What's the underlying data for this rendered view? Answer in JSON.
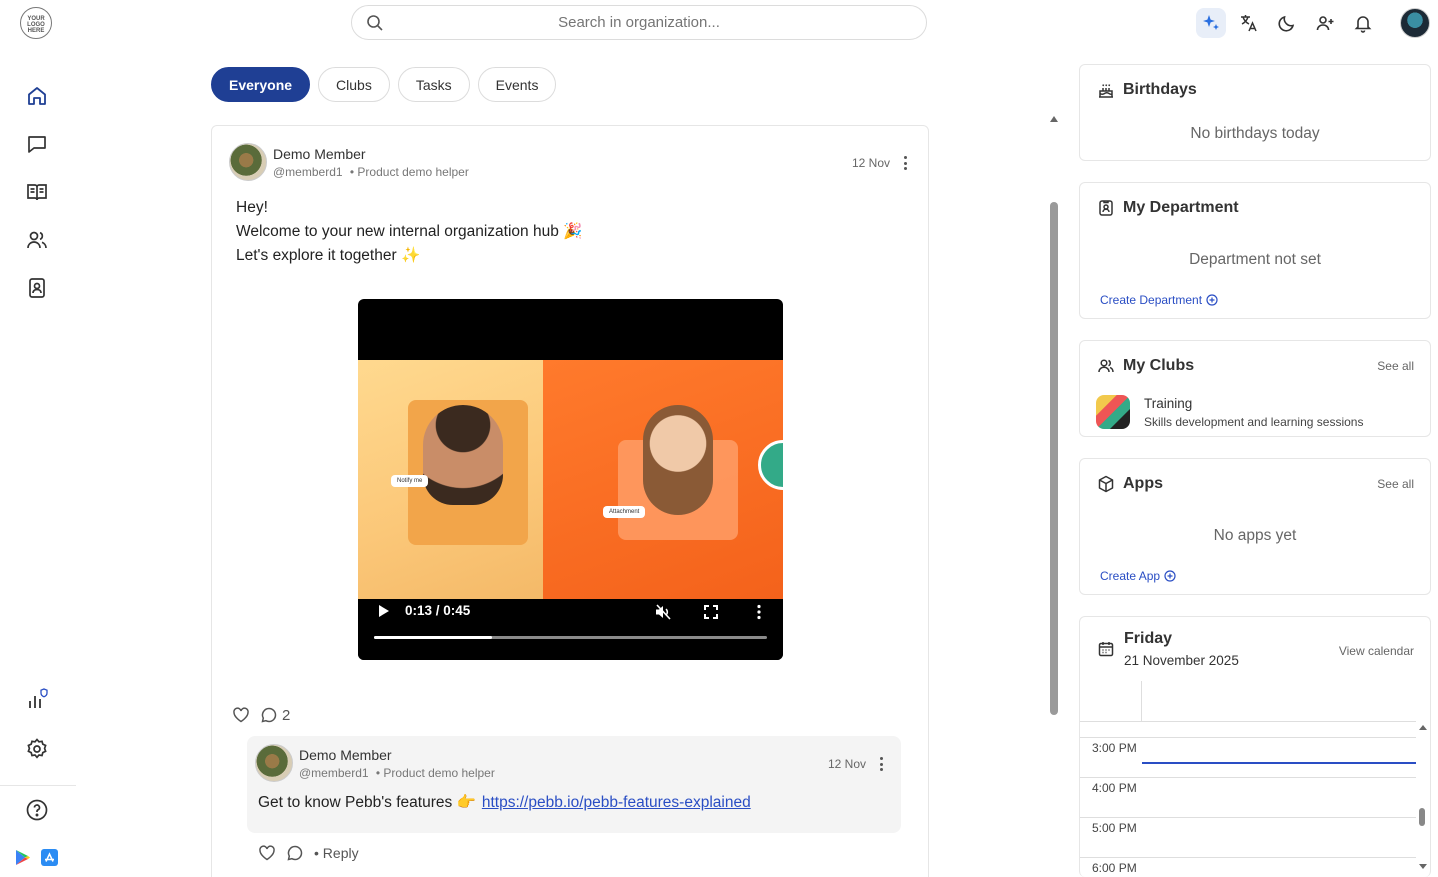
{
  "app": {
    "logo_text": "YOUR LOGO HERE"
  },
  "search": {
    "placeholder": "Search in organization..."
  },
  "tabs": [
    {
      "label": "Everyone",
      "active": true
    },
    {
      "label": "Clubs"
    },
    {
      "label": "Tasks"
    },
    {
      "label": "Events"
    }
  ],
  "post": {
    "author": "Demo Member",
    "handle": "@memberd1",
    "role": "• Product demo helper",
    "date": "12 Nov",
    "lines": [
      "Hey!",
      "Welcome to your new internal organization hub 🎉",
      "Let's explore it together ✨"
    ],
    "video": {
      "time": "0:13 / 0:45",
      "progress": 0.3,
      "chip_notify": "Notify me",
      "chip_attach": "Attachment"
    },
    "comment_count": "2"
  },
  "comment": {
    "author": "Demo Member",
    "handle": "@memberd1",
    "role": "• Product demo helper",
    "date": "12 Nov",
    "text": "Get to know Pebb's features 👉",
    "link": "https://pebb.io/pebb-features-explained",
    "reply_label": "• Reply"
  },
  "widgets": {
    "birthdays": {
      "title": "Birthdays",
      "empty": "No birthdays today"
    },
    "department": {
      "title": "My Department",
      "empty": "Department not set",
      "link": "Create Department"
    },
    "clubs": {
      "title": "My Clubs",
      "see_all": "See all",
      "items": [
        {
          "name": "Training",
          "desc": "Skills development and learning sessions"
        }
      ]
    },
    "apps": {
      "title": "Apps",
      "see_all": "See all",
      "empty": "No apps yet",
      "link": "Create App"
    },
    "calendar": {
      "day": "Friday",
      "date": "21 November 2025",
      "link": "View calendar",
      "times": [
        "3:00 PM",
        "4:00 PM",
        "5:00 PM",
        "6:00 PM"
      ]
    }
  },
  "colors": {
    "accent": "#1f3f94",
    "link": "#2a4ec4"
  }
}
